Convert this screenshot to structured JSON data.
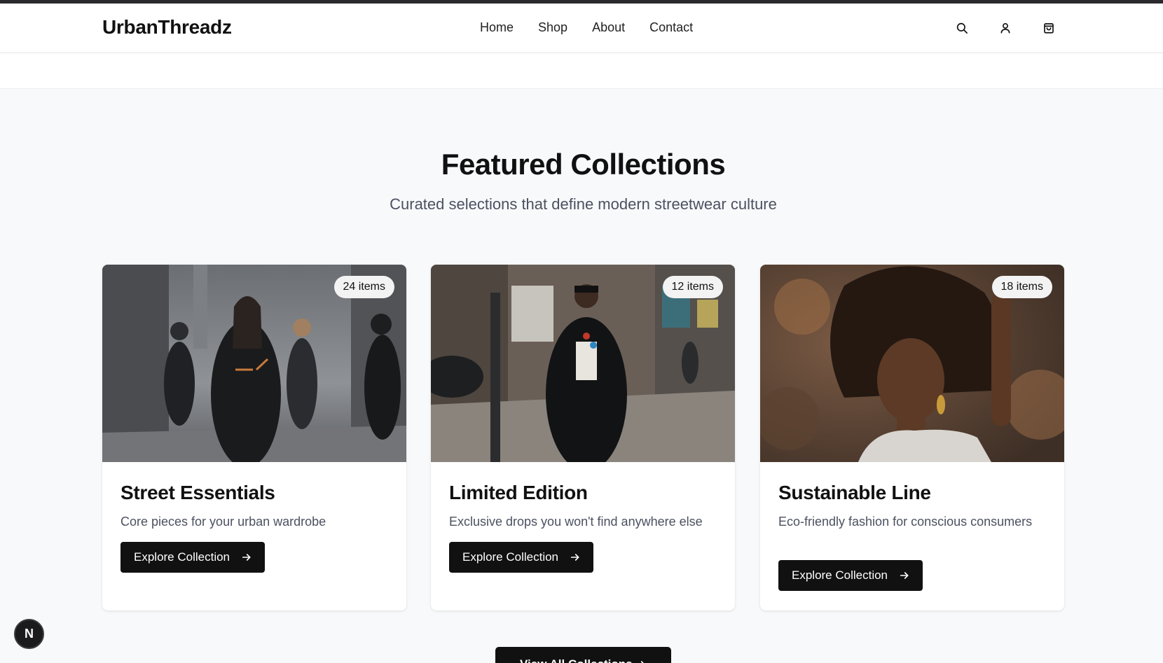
{
  "brand": "UrbanThreadz",
  "nav": {
    "items": [
      "Home",
      "Shop",
      "About",
      "Contact"
    ]
  },
  "header_icons": [
    "search-icon",
    "user-icon",
    "shopping-bag-icon"
  ],
  "section": {
    "title": "Featured Collections",
    "subtitle": "Curated selections that define modern streetwear culture"
  },
  "collections": [
    {
      "title": "Street Essentials",
      "description": "Core pieces for your urban wardrobe",
      "count": "24 items",
      "cta": "Explore Collection"
    },
    {
      "title": "Limited Edition",
      "description": "Exclusive drops you won't find anywhere else",
      "count": "12 items",
      "cta": "Explore Collection"
    },
    {
      "title": "Sustainable Line",
      "description": "Eco-friendly fashion for conscious consumers",
      "count": "18 items",
      "cta": "Explore Collection"
    }
  ],
  "view_all": "View All Collections",
  "dev_badge": "N",
  "colors": {
    "primary": "#111111",
    "page_bg": "#f8f9fb",
    "muted_text": "#4b5160",
    "badge_bg": "#f3f3f3"
  }
}
